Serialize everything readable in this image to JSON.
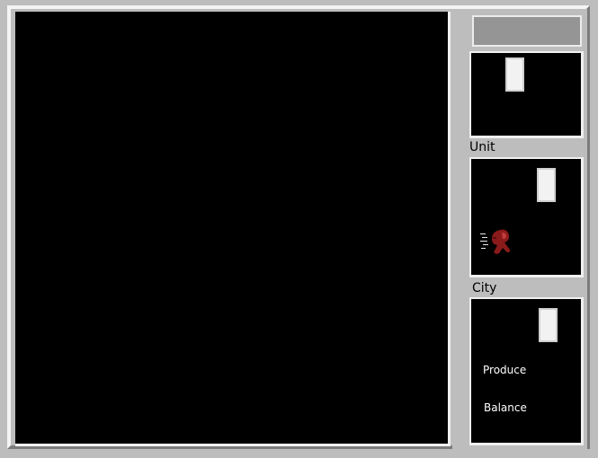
{
  "side_panel": {
    "unit_label": "Unit",
    "city_label": "City"
  },
  "city": {
    "produce_label": "Produce",
    "balance_label": "Balance"
  },
  "unit": {
    "sprite_icon": "settler-unit-icon"
  },
  "colors": {
    "frame": "#bdbdbd",
    "status_bar": "#959595",
    "pane_background": "#000000",
    "bevel_light": "#f0f0f0",
    "unit_red": "#8b1a1a"
  }
}
